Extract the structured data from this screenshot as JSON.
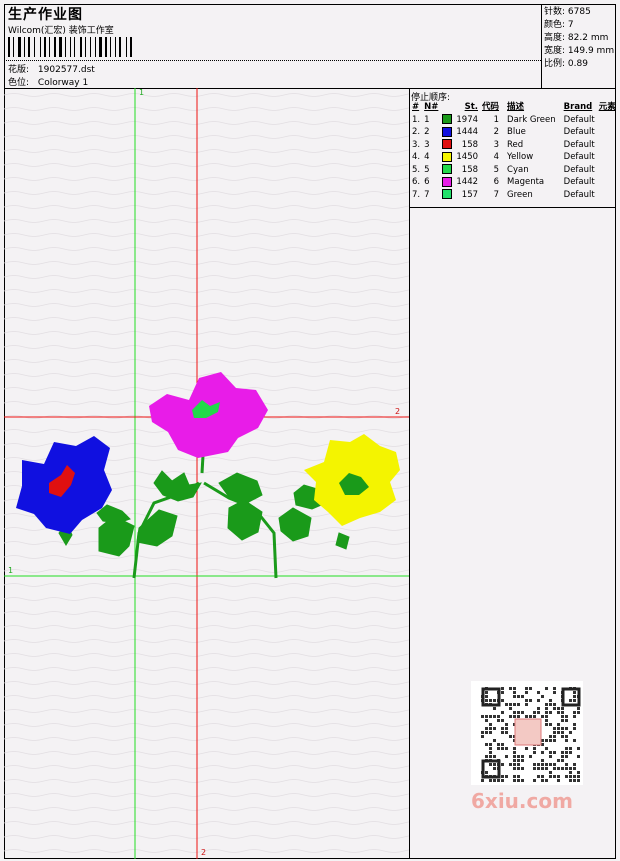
{
  "header": {
    "title": "生产作业图",
    "company": "Wilcom(汇宏) 装饰工作室",
    "design_file_label": "花版:",
    "design_file": "1902577.dst",
    "colorway_label": "色位:",
    "colorway": "Colorway 1"
  },
  "specs": {
    "stitches_label": "针数:",
    "stitches": "6785",
    "colors_label": "颜色:",
    "colors": "7",
    "height_label": "高度:",
    "height": "82.2 mm",
    "width_label": "宽度:",
    "width": "149.9 mm",
    "ratio_label": "比例:",
    "ratio": "0.89"
  },
  "stop_sequence": {
    "title": "停止顺序:",
    "headers": [
      "#",
      "N#",
      "St.",
      "代码",
      "描述",
      "Brand",
      "元素"
    ],
    "rows": [
      {
        "idx": "1.",
        "n": "1",
        "color": "#1a9a1a",
        "st": "1974",
        "code": "1",
        "desc": "Dark Green",
        "brand": "Default"
      },
      {
        "idx": "2.",
        "n": "2",
        "color": "#1010e0",
        "st": "1444",
        "code": "2",
        "desc": "Blue",
        "brand": "Default"
      },
      {
        "idx": "3.",
        "n": "3",
        "color": "#e01010",
        "st": "158",
        "code": "3",
        "desc": "Red",
        "brand": "Default"
      },
      {
        "idx": "4.",
        "n": "4",
        "color": "#f4f400",
        "st": "1450",
        "code": "4",
        "desc": "Yellow",
        "brand": "Default"
      },
      {
        "idx": "5.",
        "n": "5",
        "color": "#22d94a",
        "st": "158",
        "code": "5",
        "desc": "Cyan",
        "brand": "Default"
      },
      {
        "idx": "6.",
        "n": "6",
        "color": "#e81ce8",
        "st": "1442",
        "code": "6",
        "desc": "Magenta",
        "brand": "Default"
      },
      {
        "idx": "7.",
        "n": "7",
        "color": "#22e06a",
        "st": "157",
        "code": "7",
        "desc": "Green",
        "brand": "Default"
      }
    ]
  },
  "axes": {
    "green_top_label": "1",
    "green_left_label": "1",
    "red_right_label": "2",
    "red_bottom_label": "2",
    "green_color": "#22dd22",
    "red_color": "#ee1111"
  },
  "watermark": {
    "text": "6xiu.com",
    "color": "#f0a9a3"
  }
}
